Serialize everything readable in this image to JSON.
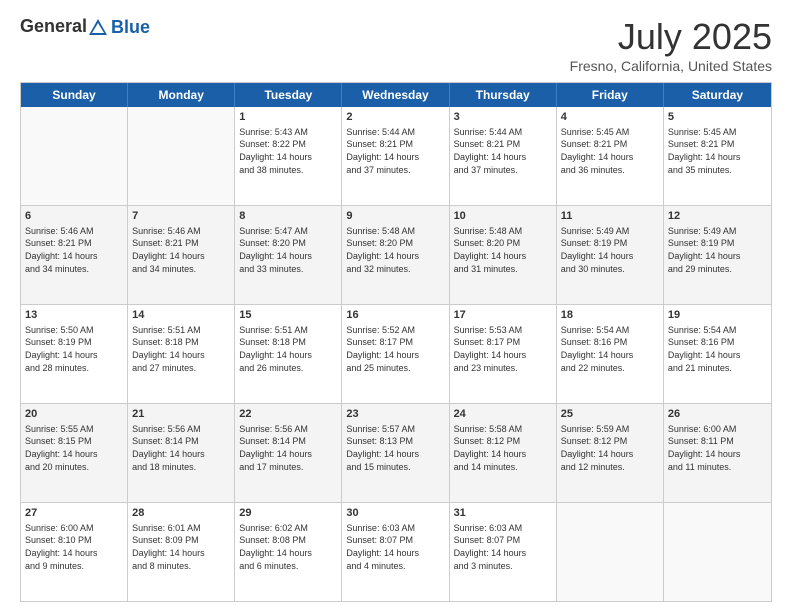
{
  "header": {
    "logo_general": "General",
    "logo_blue": "Blue",
    "title": "July 2025",
    "subtitle": "Fresno, California, United States"
  },
  "weekdays": [
    "Sunday",
    "Monday",
    "Tuesday",
    "Wednesday",
    "Thursday",
    "Friday",
    "Saturday"
  ],
  "rows": [
    [
      {
        "day": "",
        "empty": true
      },
      {
        "day": "",
        "empty": true
      },
      {
        "day": "1",
        "lines": [
          "Sunrise: 5:43 AM",
          "Sunset: 8:22 PM",
          "Daylight: 14 hours",
          "and 38 minutes."
        ]
      },
      {
        "day": "2",
        "lines": [
          "Sunrise: 5:44 AM",
          "Sunset: 8:21 PM",
          "Daylight: 14 hours",
          "and 37 minutes."
        ]
      },
      {
        "day": "3",
        "lines": [
          "Sunrise: 5:44 AM",
          "Sunset: 8:21 PM",
          "Daylight: 14 hours",
          "and 37 minutes."
        ]
      },
      {
        "day": "4",
        "lines": [
          "Sunrise: 5:45 AM",
          "Sunset: 8:21 PM",
          "Daylight: 14 hours",
          "and 36 minutes."
        ]
      },
      {
        "day": "5",
        "lines": [
          "Sunrise: 5:45 AM",
          "Sunset: 8:21 PM",
          "Daylight: 14 hours",
          "and 35 minutes."
        ]
      }
    ],
    [
      {
        "day": "6",
        "lines": [
          "Sunrise: 5:46 AM",
          "Sunset: 8:21 PM",
          "Daylight: 14 hours",
          "and 34 minutes."
        ],
        "alt": true
      },
      {
        "day": "7",
        "lines": [
          "Sunrise: 5:46 AM",
          "Sunset: 8:21 PM",
          "Daylight: 14 hours",
          "and 34 minutes."
        ],
        "alt": true
      },
      {
        "day": "8",
        "lines": [
          "Sunrise: 5:47 AM",
          "Sunset: 8:20 PM",
          "Daylight: 14 hours",
          "and 33 minutes."
        ],
        "alt": true
      },
      {
        "day": "9",
        "lines": [
          "Sunrise: 5:48 AM",
          "Sunset: 8:20 PM",
          "Daylight: 14 hours",
          "and 32 minutes."
        ],
        "alt": true
      },
      {
        "day": "10",
        "lines": [
          "Sunrise: 5:48 AM",
          "Sunset: 8:20 PM",
          "Daylight: 14 hours",
          "and 31 minutes."
        ],
        "alt": true
      },
      {
        "day": "11",
        "lines": [
          "Sunrise: 5:49 AM",
          "Sunset: 8:19 PM",
          "Daylight: 14 hours",
          "and 30 minutes."
        ],
        "alt": true
      },
      {
        "day": "12",
        "lines": [
          "Sunrise: 5:49 AM",
          "Sunset: 8:19 PM",
          "Daylight: 14 hours",
          "and 29 minutes."
        ],
        "alt": true
      }
    ],
    [
      {
        "day": "13",
        "lines": [
          "Sunrise: 5:50 AM",
          "Sunset: 8:19 PM",
          "Daylight: 14 hours",
          "and 28 minutes."
        ]
      },
      {
        "day": "14",
        "lines": [
          "Sunrise: 5:51 AM",
          "Sunset: 8:18 PM",
          "Daylight: 14 hours",
          "and 27 minutes."
        ]
      },
      {
        "day": "15",
        "lines": [
          "Sunrise: 5:51 AM",
          "Sunset: 8:18 PM",
          "Daylight: 14 hours",
          "and 26 minutes."
        ]
      },
      {
        "day": "16",
        "lines": [
          "Sunrise: 5:52 AM",
          "Sunset: 8:17 PM",
          "Daylight: 14 hours",
          "and 25 minutes."
        ]
      },
      {
        "day": "17",
        "lines": [
          "Sunrise: 5:53 AM",
          "Sunset: 8:17 PM",
          "Daylight: 14 hours",
          "and 23 minutes."
        ]
      },
      {
        "day": "18",
        "lines": [
          "Sunrise: 5:54 AM",
          "Sunset: 8:16 PM",
          "Daylight: 14 hours",
          "and 22 minutes."
        ]
      },
      {
        "day": "19",
        "lines": [
          "Sunrise: 5:54 AM",
          "Sunset: 8:16 PM",
          "Daylight: 14 hours",
          "and 21 minutes."
        ]
      }
    ],
    [
      {
        "day": "20",
        "lines": [
          "Sunrise: 5:55 AM",
          "Sunset: 8:15 PM",
          "Daylight: 14 hours",
          "and 20 minutes."
        ],
        "alt": true
      },
      {
        "day": "21",
        "lines": [
          "Sunrise: 5:56 AM",
          "Sunset: 8:14 PM",
          "Daylight: 14 hours",
          "and 18 minutes."
        ],
        "alt": true
      },
      {
        "day": "22",
        "lines": [
          "Sunrise: 5:56 AM",
          "Sunset: 8:14 PM",
          "Daylight: 14 hours",
          "and 17 minutes."
        ],
        "alt": true
      },
      {
        "day": "23",
        "lines": [
          "Sunrise: 5:57 AM",
          "Sunset: 8:13 PM",
          "Daylight: 14 hours",
          "and 15 minutes."
        ],
        "alt": true
      },
      {
        "day": "24",
        "lines": [
          "Sunrise: 5:58 AM",
          "Sunset: 8:12 PM",
          "Daylight: 14 hours",
          "and 14 minutes."
        ],
        "alt": true
      },
      {
        "day": "25",
        "lines": [
          "Sunrise: 5:59 AM",
          "Sunset: 8:12 PM",
          "Daylight: 14 hours",
          "and 12 minutes."
        ],
        "alt": true
      },
      {
        "day": "26",
        "lines": [
          "Sunrise: 6:00 AM",
          "Sunset: 8:11 PM",
          "Daylight: 14 hours",
          "and 11 minutes."
        ],
        "alt": true
      }
    ],
    [
      {
        "day": "27",
        "lines": [
          "Sunrise: 6:00 AM",
          "Sunset: 8:10 PM",
          "Daylight: 14 hours",
          "and 9 minutes."
        ]
      },
      {
        "day": "28",
        "lines": [
          "Sunrise: 6:01 AM",
          "Sunset: 8:09 PM",
          "Daylight: 14 hours",
          "and 8 minutes."
        ]
      },
      {
        "day": "29",
        "lines": [
          "Sunrise: 6:02 AM",
          "Sunset: 8:08 PM",
          "Daylight: 14 hours",
          "and 6 minutes."
        ]
      },
      {
        "day": "30",
        "lines": [
          "Sunrise: 6:03 AM",
          "Sunset: 8:07 PM",
          "Daylight: 14 hours",
          "and 4 minutes."
        ]
      },
      {
        "day": "31",
        "lines": [
          "Sunrise: 6:03 AM",
          "Sunset: 8:07 PM",
          "Daylight: 14 hours",
          "and 3 minutes."
        ]
      },
      {
        "day": "",
        "empty": true
      },
      {
        "day": "",
        "empty": true
      }
    ]
  ]
}
